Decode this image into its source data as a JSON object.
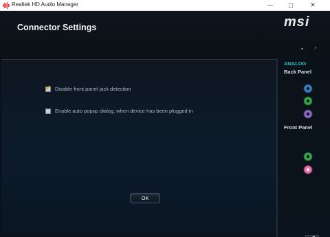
{
  "window": {
    "title": "Realtek HD Audio Manager",
    "controls": {
      "minimize": "—",
      "maximize": "☐",
      "close": "✕"
    }
  },
  "header": {
    "title": "Connector Settings",
    "brand": "msi"
  },
  "options": [
    {
      "label": "Disable front panel jack detection",
      "checked": true
    },
    {
      "label": "Enable auto popup dialog, when device has been plugged in",
      "checked": false
    }
  ],
  "ok_button": {
    "label": "OK"
  },
  "sidebar": {
    "section_title": "ANALOG",
    "back_panel_label": "Back Panel",
    "front_panel_label": "Front Panel",
    "back_jacks": [
      {
        "name": "blue-jack",
        "color": "#3e7fc4"
      },
      {
        "name": "green-jack",
        "color": "#3aa84a"
      },
      {
        "name": "purple-jack",
        "color": "#8a6bc0"
      }
    ],
    "front_jacks": [
      {
        "name": "green-jack",
        "color": "#3aa84a"
      },
      {
        "name": "pink-jack",
        "color": "#e76fa5"
      }
    ]
  },
  "colors": {
    "accent": "#2ab8c4",
    "section_label": "#d9dfe5",
    "check_mark": "#e0a21c"
  },
  "icons": {
    "settings": "gear-icon",
    "info": "info-icon",
    "tool": "wrench-icon"
  }
}
